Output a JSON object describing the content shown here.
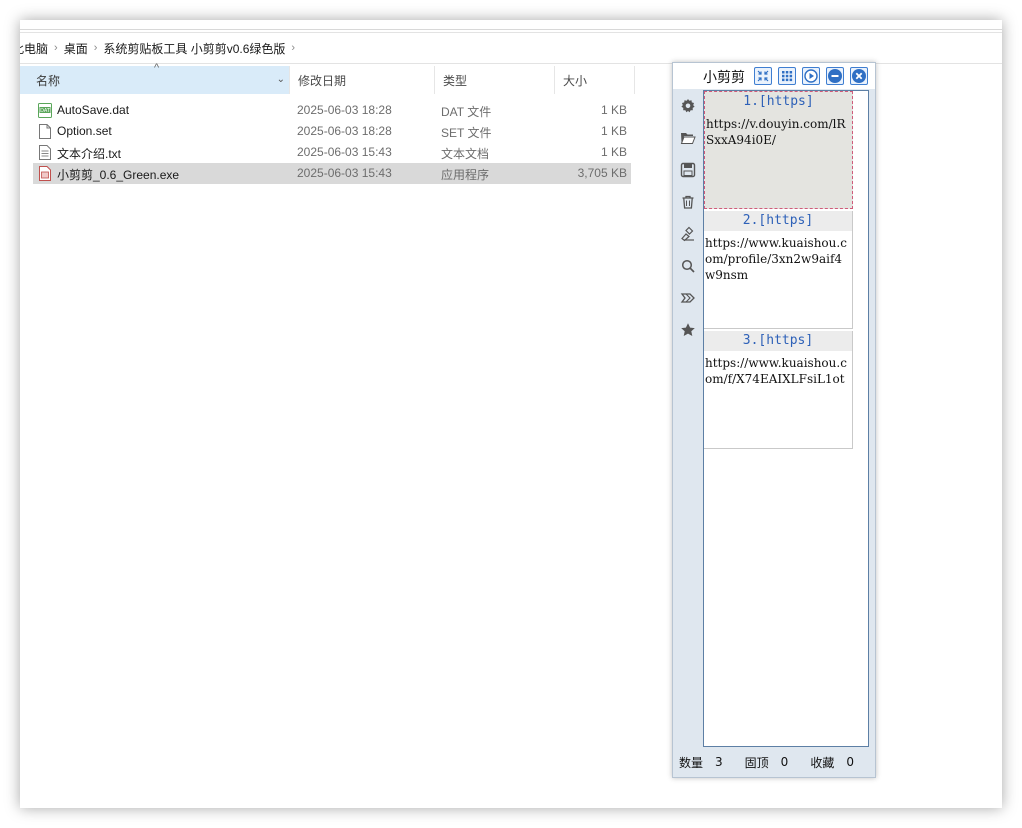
{
  "explorer": {
    "breadcrumb": [
      "此电脑",
      "桌面",
      "系统剪贴板工具 小剪剪v0.6绿色版"
    ],
    "columns": {
      "name": "名称",
      "date": "修改日期",
      "type": "类型",
      "size": "大小"
    },
    "files": [
      {
        "name": "AutoSave.dat",
        "date": "2025-06-03 18:28",
        "type": "DAT 文件",
        "size": "1 KB",
        "icon": "dat-file-icon"
      },
      {
        "name": "Option.set",
        "date": "2025-06-03 18:28",
        "type": "SET 文件",
        "size": "1 KB",
        "icon": "blank-file-icon"
      },
      {
        "name": "文本介绍.txt",
        "date": "2025-06-03 15:43",
        "type": "文本文档",
        "size": "1 KB",
        "icon": "text-file-icon"
      },
      {
        "name": "小剪剪_0.6_Green.exe",
        "date": "2025-06-03 15:43",
        "type": "应用程序",
        "size": "3,705 KB",
        "icon": "exe-file-icon",
        "selected": true
      }
    ]
  },
  "clipper": {
    "title": "小剪剪",
    "toolbar": [
      "collapse-icon",
      "grid-icon",
      "play-icon",
      "minimize-icon",
      "close-icon"
    ],
    "sidebar": [
      "gear-icon",
      "open-folder-icon",
      "save-icon",
      "trash-icon",
      "brush-icon",
      "search-icon",
      "tag-icon",
      "star-icon"
    ],
    "entries": [
      {
        "header": "1.[https]",
        "text": "https://v.douyin.com/lRSxxA94i0E/"
      },
      {
        "header": "2.[https]",
        "text": "https://www.kuaishou.com/profile/3xn2w9aif4w9nsm"
      },
      {
        "header": "3.[https]",
        "text": "https://www.kuaishou.com/f/X74EAIXLFsiL1ot"
      }
    ],
    "status": {
      "count_label": "数量",
      "count_value": "3",
      "pinned_label": "固顶",
      "pinned_value": "0",
      "fav_label": "收藏",
      "fav_value": "0"
    },
    "accent": "#3f7ed1"
  }
}
